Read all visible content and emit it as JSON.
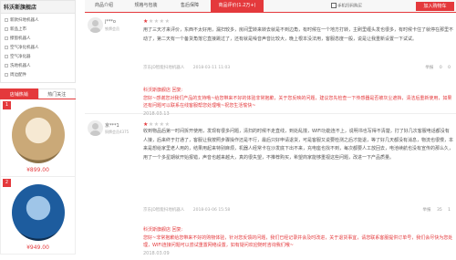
{
  "sidebar": {
    "shop_title": "科沃斯旗舰店",
    "categories": [
      "新款扫地机器人",
      "新品上市",
      "擦窗机器人",
      "空气净化机器人",
      "空气净化器",
      "洗地机器人",
      "周边配件"
    ],
    "rank_tabs": [
      "店铺热销",
      "热门关注"
    ],
    "products": [
      {
        "rank": "1",
        "price": "¥899.00"
      },
      {
        "rank": "2",
        "price": "¥949.00"
      }
    ]
  },
  "tabs": {
    "items": [
      "商品介绍",
      "规格与包装",
      "售后保障",
      "商品评价(1.2万+)"
    ],
    "qr_label": "手机扫码购买",
    "cart_button": "加入购物车"
  },
  "reviews": [
    {
      "user": "j***o",
      "level": "铁牌会员",
      "stars": 1,
      "text": "用了三天才来评价，东西不太好用，漏扫较多，房间里转来转去就是不到边角，有时候在一个地方打转，主刷里缠头发也很多，有时候卡住了就停在那里不动了，第二天有一个备货角落它直接跳过了，还有就是噪音声音比较大，晚上根本没法用，客服态度一般，说是让我重新设置一下试试。",
      "product": "京东JD智能扫地机器人",
      "date": "2018-03-11 11:03",
      "reply_head": "科沃斯旗舰店 回复:",
      "reply": "您好~感谢您对我们产品的支持哦~给您带来不好的体验非常抱歉，关于您反映的问题，建议您先检查一下传感器是否被灰尘遮挡，清洁后重新使用，如果还有问题可以联系在线客服帮您处理哦~祝您生活愉快~",
      "reply_date": "2018.03.13",
      "actions": [
        "举报",
        "0",
        "0"
      ]
    },
    {
      "user": "京***1",
      "level": "铜牌会员4375",
      "stars": 1,
      "text": "收到物品后第一时间拆开使用，发现有很多问题，清扫的时候不走直线，到处乱撞，WIFI功能连不上，说明书也写得不清楚，打了好几次客服电话都没有人接，后来终于打通了，客服让我按照步骤操作还是不行，最后只好申请退货，可是客服又说要检测之后才能退，等了好几天都没有消息，物流也很慢，本来是想给家里老人用的，结果用起来特别麻烦，机器人经常卡在沙发底下出不来，充电座也找不到，每次都要人工放回去，电池续航也没有宣传的那么久，用了一个多星期就开始报错，声音也越来越大，真的很失望，不推荐购买，希望商家能够重视这些问题，改进一下产品质量。",
      "product": "京东JD智能扫地机器人",
      "date": "2018-03-06 15:58",
      "reply_head": "科沃斯旗舰店 回复:",
      "reply": "您好~非常抱歉给您带来不好的购物体验，针对您反馈的问题，我们已经记录并会及时改进，关于退货事宜，请您联系客服提供订单号，我们会尽快为您处理，WIFI连接问题可以尝试重置网络设置，如有疑问欢迎随时咨询我们哦~",
      "reply_date": "2018.03.09",
      "actions": [
        "举报",
        "35",
        "1"
      ]
    }
  ],
  "colors": {
    "accent": "#e4393c"
  }
}
